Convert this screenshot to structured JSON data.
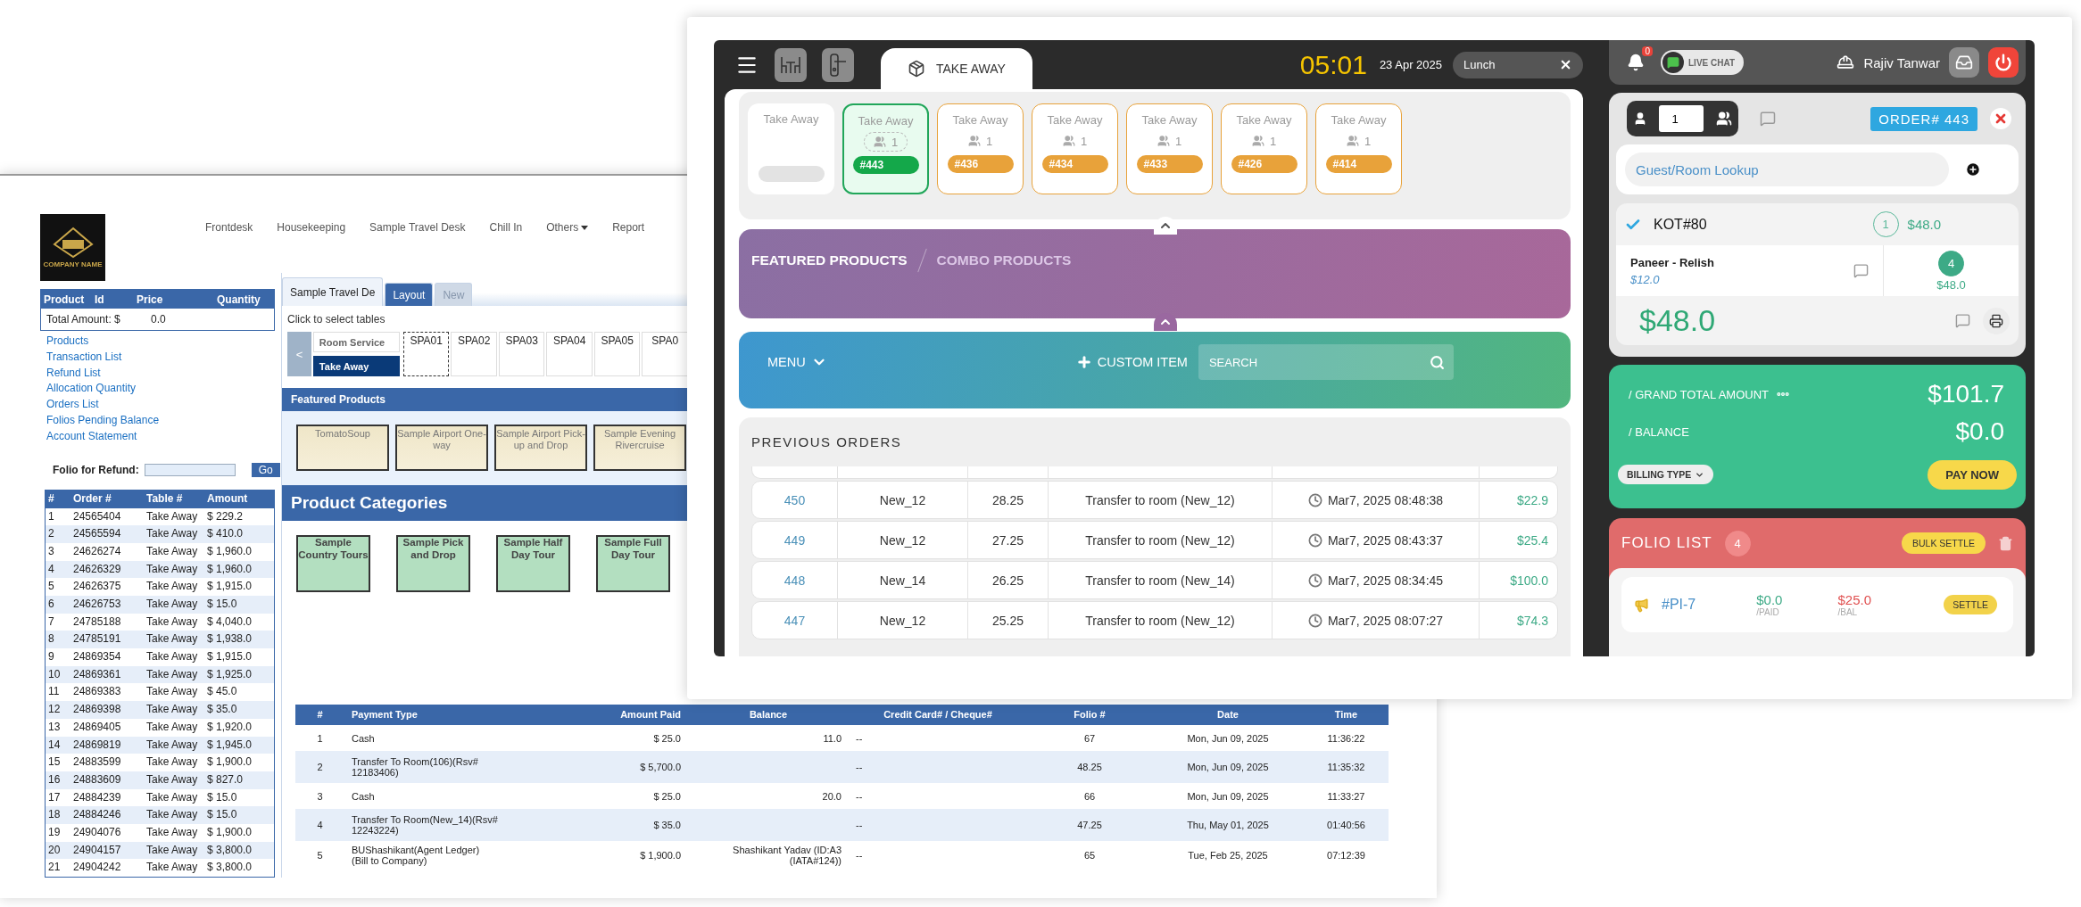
{
  "back_window": {
    "logo": {
      "caption": "COMPANY NAME"
    },
    "nav": [
      {
        "label": "Frontdesk",
        "has_menu": false
      },
      {
        "label": "Housekeeping",
        "has_menu": false
      },
      {
        "label": "Sample Travel Desk",
        "has_menu": false
      },
      {
        "label": "Chill In",
        "has_menu": false
      },
      {
        "label": "Others",
        "has_menu": true
      },
      {
        "label": "Report",
        "has_menu": false
      }
    ],
    "cart": {
      "columns": [
        "Product",
        "Id",
        "Price",
        "Quantity"
      ],
      "total_label": "Total Amount: $",
      "total_value": "0.0"
    },
    "links": [
      "Products",
      "Transaction List",
      "Refund List",
      "Allocation Quantity",
      "Orders List",
      "Folios Pending Balance",
      "Account Statement"
    ],
    "refund": {
      "label": "Folio for Refund:",
      "button": "Go"
    },
    "orders": {
      "columns": [
        "#",
        "Order #",
        "Table #",
        "Amount"
      ],
      "rows": [
        [
          "1",
          "24565404",
          "Take Away",
          "$ 229.2"
        ],
        [
          "2",
          "24565594",
          "Take Away",
          "$ 410.0"
        ],
        [
          "3",
          "24626274",
          "Take Away",
          "$ 1,960.0"
        ],
        [
          "4",
          "24626329",
          "Take Away",
          "$ 1,960.0"
        ],
        [
          "5",
          "24626375",
          "Take Away",
          "$ 1,915.0"
        ],
        [
          "6",
          "24626753",
          "Take Away",
          "$ 15.0"
        ],
        [
          "7",
          "24785188",
          "Take Away",
          "$ 4,040.0"
        ],
        [
          "8",
          "24785191",
          "Take Away",
          "$ 1,938.0"
        ],
        [
          "9",
          "24869354",
          "Take Away",
          "$ 1,915.0"
        ],
        [
          "10",
          "24869361",
          "Take Away",
          "$ 1,925.0"
        ],
        [
          "11",
          "24869383",
          "Take Away",
          "$ 45.0"
        ],
        [
          "12",
          "24869398",
          "Take Away",
          "$ 35.0"
        ],
        [
          "13",
          "24869405",
          "Take Away",
          "$ 1,920.0"
        ],
        [
          "14",
          "24869819",
          "Take Away",
          "$ 1,945.0"
        ],
        [
          "15",
          "24883599",
          "Take Away",
          "$ 1,900.0"
        ],
        [
          "16",
          "24883609",
          "Take Away",
          "$ 827.0"
        ],
        [
          "17",
          "24884239",
          "Take Away",
          "$ 15.0"
        ],
        [
          "18",
          "24884246",
          "Take Away",
          "$ 15.0"
        ],
        [
          "19",
          "24904076",
          "Take Away",
          "$ 1,900.0"
        ],
        [
          "20",
          "24904157",
          "Take Away",
          "$ 3,800.0"
        ],
        [
          "21",
          "24904242",
          "Take Away",
          "$ 3,800.0"
        ]
      ]
    },
    "tabs": [
      {
        "label": "Sample Travel De",
        "selected": true,
        "disabled": false
      },
      {
        "label": "Layout",
        "selected": false,
        "disabled": false
      },
      {
        "label": "New",
        "selected": false,
        "disabled": true
      }
    ],
    "hint": "Click to select tables",
    "prev_button": "<",
    "areas": [
      {
        "label": "Room Service",
        "selected": false
      },
      {
        "label": "Take Away",
        "selected": true
      }
    ],
    "tables": [
      {
        "label": "SPA01",
        "selected": true
      },
      {
        "label": "SPA02",
        "selected": false
      },
      {
        "label": "SPA03",
        "selected": false
      },
      {
        "label": "SPA04",
        "selected": false
      },
      {
        "label": "SPA05",
        "selected": false
      },
      {
        "label": "SPA0",
        "selected": false
      }
    ],
    "featured": {
      "title": "Featured Products",
      "items": [
        "TomatoSoup",
        "Sample Airport One-way",
        "Sample Airport Pick-up and Drop",
        "Sample Evening Rivercruise"
      ]
    },
    "categories": {
      "title": "Product Categories",
      "items": [
        "Sample Country Tours",
        "Sample Pick and Drop",
        "Sample Half Day Tour",
        "Sample Full Day Tour"
      ]
    },
    "payments": {
      "columns": [
        "#",
        "Payment Type",
        "Amount Paid",
        "Balance",
        "Credit Card# / Cheque#",
        "Folio #",
        "Date",
        "Time"
      ],
      "rows": [
        {
          "n": "1",
          "type": "Cash",
          "paid": "$ 25.0",
          "balance": "11.0",
          "card": "--",
          "folio": "67",
          "date": "Mon, Jun 09, 2025",
          "time": "11:36:22"
        },
        {
          "n": "2",
          "type": "Transfer To Room(106)(Rsv#\n12183406)",
          "paid": "$ 5,700.0",
          "card": "--",
          "folio": "48.25",
          "date": "Mon, Jun 09, 2025",
          "time": "11:35:32"
        },
        {
          "n": "3",
          "type": "Cash",
          "paid": "$ 25.0",
          "balance": "20.0",
          "card": "--",
          "folio": "66",
          "date": "Mon, Jun 09, 2025",
          "time": "11:33:27"
        },
        {
          "n": "4",
          "type": "Transfer To Room(New_14)(Rsv#\n12243224)",
          "paid": "$ 35.0",
          "card": "--",
          "folio": "47.25",
          "date": "Thu, May 01, 2025",
          "time": "01:40:56"
        },
        {
          "n": "5",
          "type": "BUShashikant(Agent Ledger)\n(Bill to Company)",
          "paid": "$ 1,900.0",
          "balance": "Shashikant Yadav (ID:A3\n(IATA#124))",
          "card": "--",
          "folio": "65",
          "date": "Tue, Feb 25, 2025",
          "time": "07:12:39"
        }
      ]
    }
  },
  "pos_window": {
    "topbar": {
      "tab": "TAKE AWAY",
      "clock": "05:01",
      "date": "23 Apr 2025",
      "session": "Lunch"
    },
    "tables": [
      {
        "label": "Take Away",
        "kind": "vacant",
        "selected": false
      },
      {
        "label": "Take Away",
        "kind": "occupied",
        "guests": "1",
        "order": "#443",
        "selected": true
      },
      {
        "label": "Take Away",
        "kind": "occupied",
        "guests": "1",
        "order": "#436",
        "selected": false
      },
      {
        "label": "Take Away",
        "kind": "occupied",
        "guests": "1",
        "order": "#434",
        "selected": false
      },
      {
        "label": "Take Away",
        "kind": "occupied",
        "guests": "1",
        "order": "#433",
        "selected": false
      },
      {
        "label": "Take Away",
        "kind": "occupied",
        "guests": "1",
        "order": "#426",
        "selected": false
      },
      {
        "label": "Take Away",
        "kind": "occupied",
        "guests": "1",
        "order": "#414",
        "selected": false
      }
    ],
    "product_tabs": [
      {
        "label": "FEATURED PRODUCTS",
        "selected": true
      },
      {
        "label": "COMBO PRODUCTS",
        "selected": false
      }
    ],
    "menu": {
      "label": "MENU",
      "custom_item": "CUSTOM ITEM",
      "search_placeholder": "SEARCH"
    },
    "previous_orders": {
      "title": "PREVIOUS ORDERS",
      "rows": [
        {
          "order": "450",
          "room": "New_12",
          "folio": "28.25",
          "payment": "Transfer to room (New_12)",
          "time": "Mar7, 2025 08:48:38",
          "amount": "$22.9"
        },
        {
          "order": "449",
          "room": "New_12",
          "folio": "27.25",
          "payment": "Transfer to room (New_12)",
          "time": "Mar7, 2025 08:43:37",
          "amount": "$25.4"
        },
        {
          "order": "448",
          "room": "New_14",
          "folio": "26.25",
          "payment": "Transfer to room (New_14)",
          "time": "Mar7, 2025 08:34:45",
          "amount": "$100.0"
        },
        {
          "order": "447",
          "room": "New_12",
          "folio": "25.25",
          "payment": "Transfer to room (New_12)",
          "time": "Mar7, 2025 08:07:27",
          "amount": "$74.3"
        }
      ]
    },
    "sidebar": {
      "header": {
        "notifications": "0",
        "live_chat": "LIVE CHAT",
        "user": "Rajiv Tanwar"
      },
      "order": {
        "guests": "1",
        "number": "ORDER# 443",
        "lookup_placeholder": "Guest/Room Lookup",
        "kot": {
          "label": "KOT#80",
          "checked": true,
          "count": "1",
          "amount": "$48.0"
        },
        "items": [
          {
            "name": "Paneer - Relish",
            "price": "$12.0",
            "qty": "4",
            "amount": "$48.0"
          }
        ],
        "total": "$48.0"
      },
      "payment": {
        "grand_total_label": "/ GRAND TOTAL AMOUNT",
        "grand_total": "$101.7",
        "balance_label": "/ BALANCE",
        "balance": "$0.0",
        "billing_type": "BILLING TYPE",
        "pay": "PAY NOW"
      },
      "folios": {
        "title": "FOLIO LIST",
        "count": "4",
        "bulk": "BULK SETTLE",
        "items": [
          {
            "id": "#PI-7",
            "paid": "$0.0",
            "paid_label": "/PAID",
            "balance": "$25.0",
            "balance_label": "/BAL",
            "action": "SETTLE"
          }
        ]
      }
    }
  }
}
